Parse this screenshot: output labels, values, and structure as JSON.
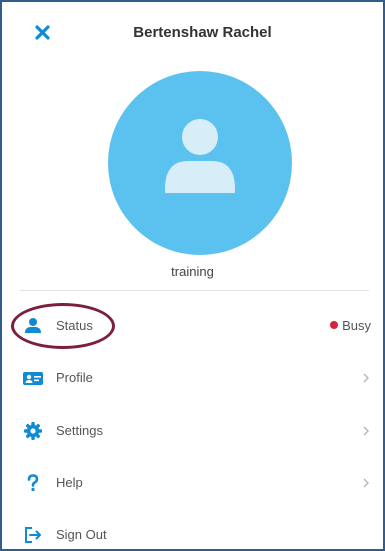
{
  "header": {
    "title": "Bertenshaw Rachel",
    "close_icon": "close-icon"
  },
  "profile": {
    "account_name": "training",
    "avatar_icon": "person-silhouette-icon"
  },
  "menu": {
    "status": {
      "label": "Status",
      "value": "Busy",
      "status_color": "#d6223b",
      "icon": "person-icon"
    },
    "profile": {
      "label": "Profile",
      "icon": "id-card-icon"
    },
    "settings": {
      "label": "Settings",
      "icon": "gear-icon"
    },
    "help": {
      "label": "Help",
      "icon": "question-icon"
    },
    "signout": {
      "label": "Sign Out",
      "icon": "sign-out-icon"
    }
  },
  "colors": {
    "accent": "#0f8ad6",
    "avatar_bg": "#5bc2ef",
    "busy": "#d6223b",
    "annotation": "#7c1f3c"
  }
}
